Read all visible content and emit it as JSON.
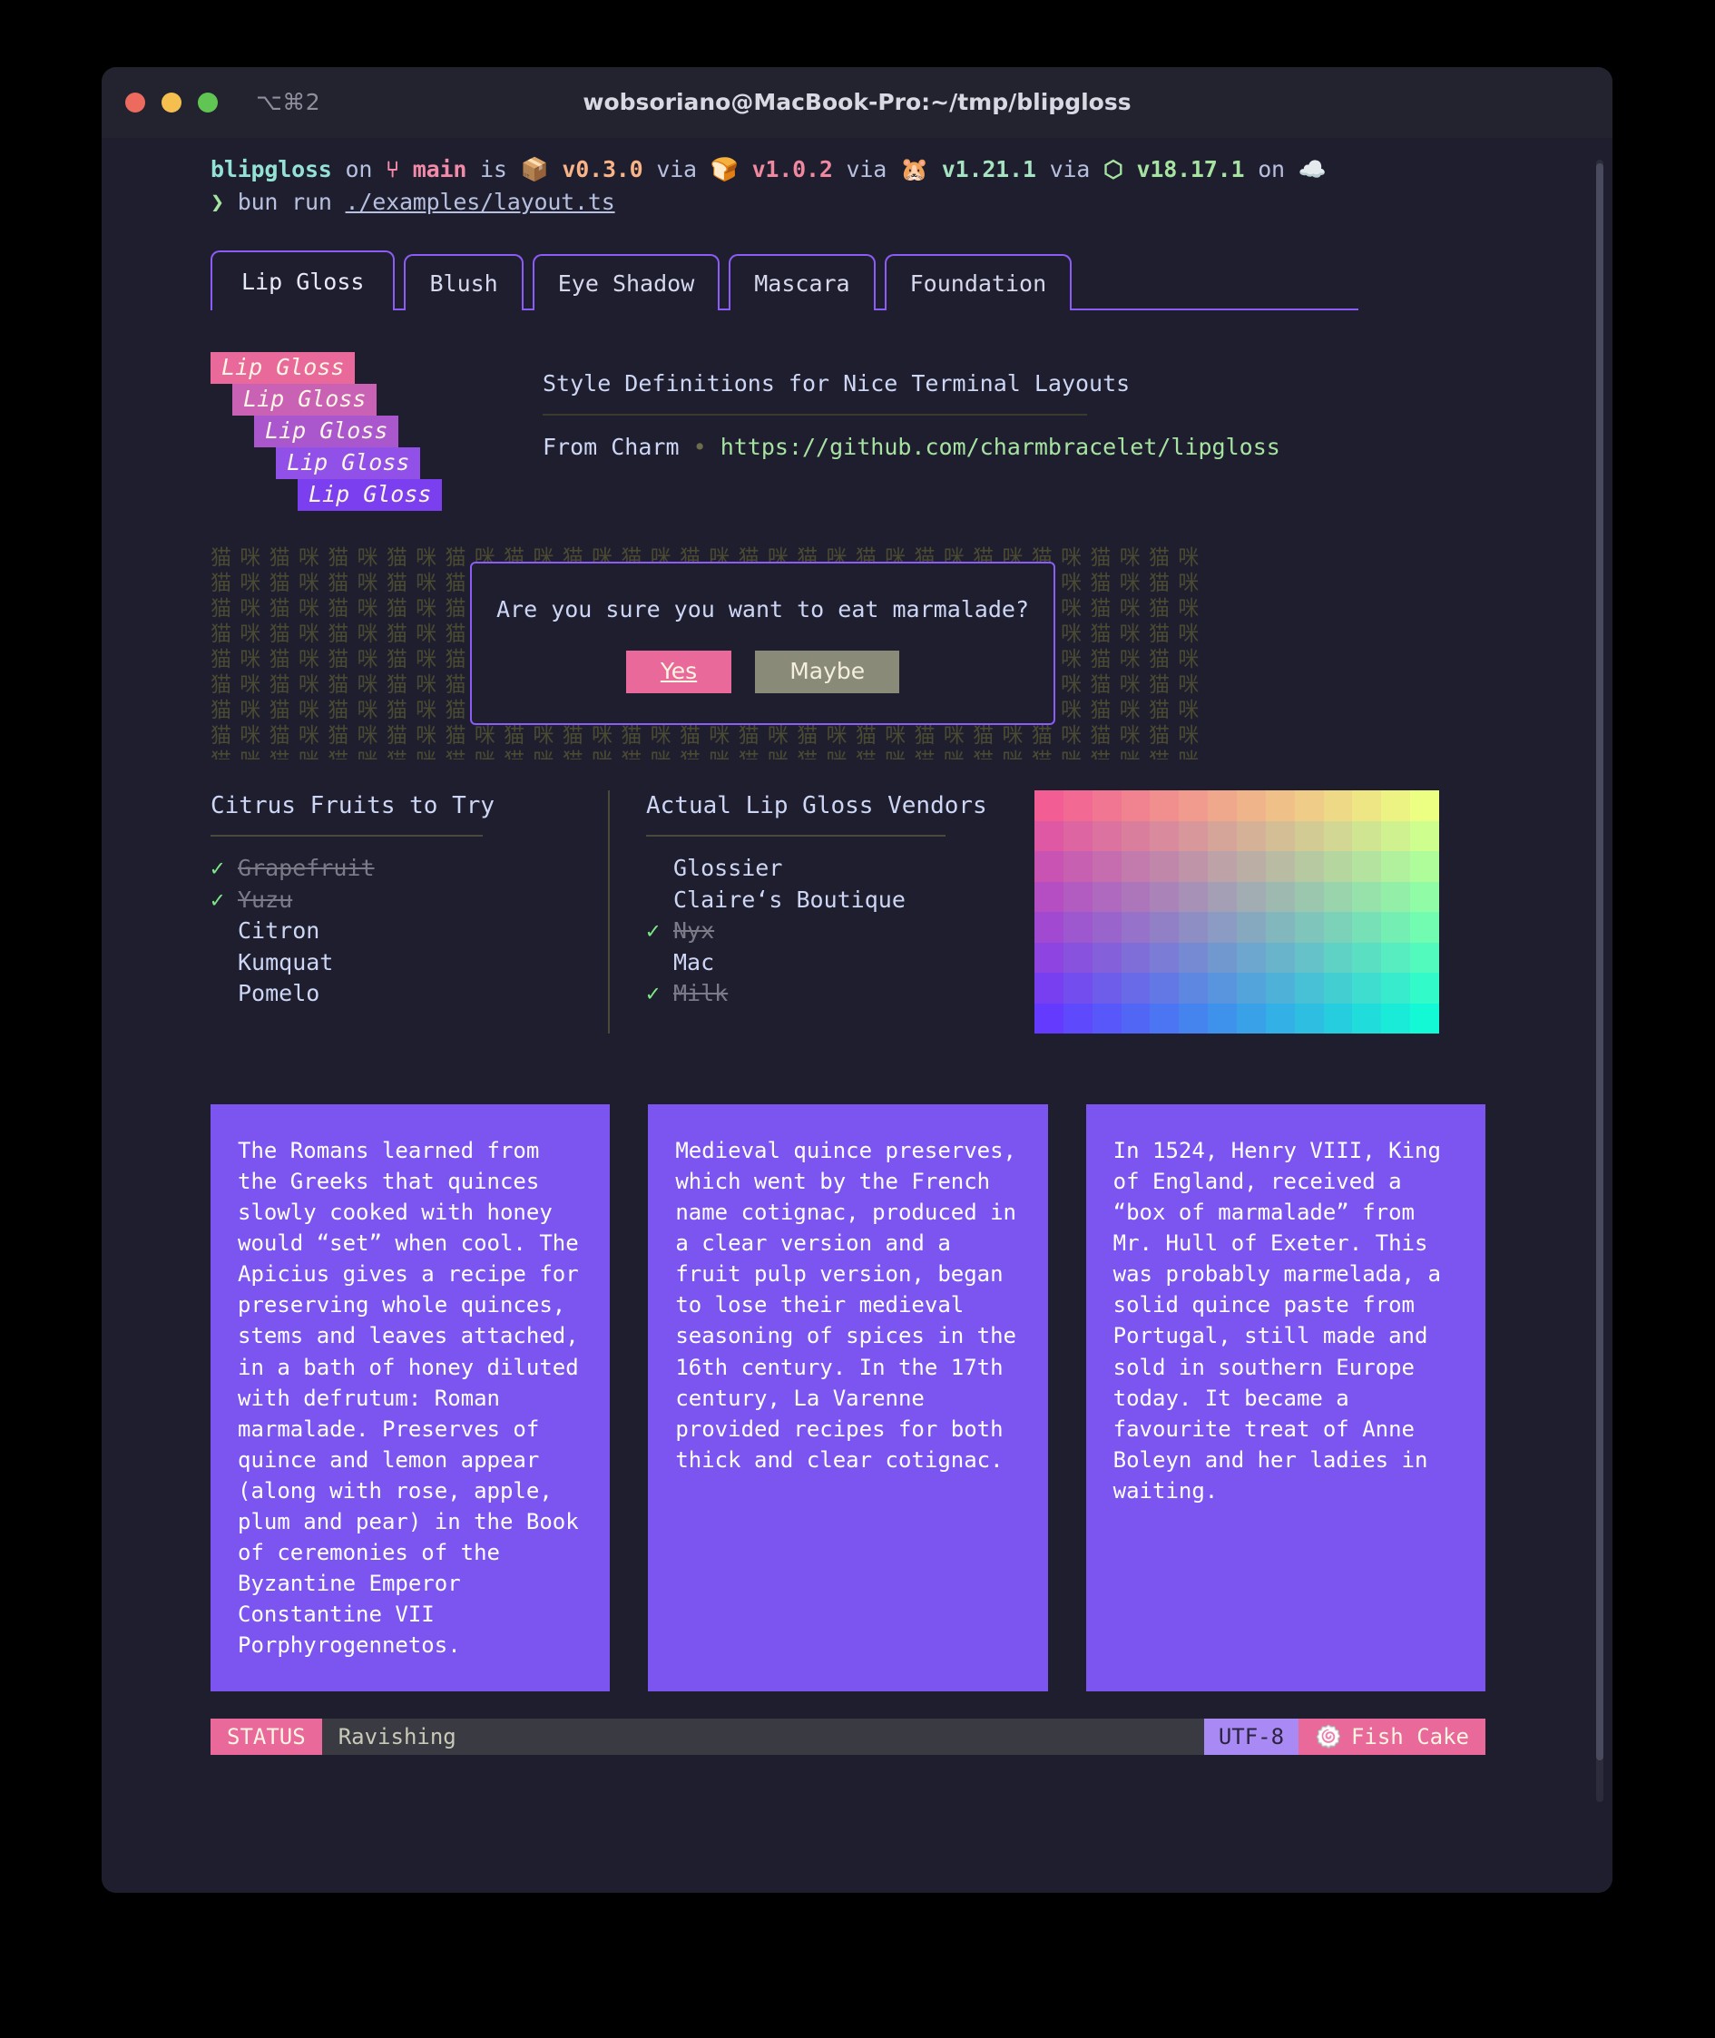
{
  "window": {
    "shortcut": "⌥⌘2",
    "title": "wobsoriano@MacBook-Pro:~/tmp/blipgloss",
    "traffic_lights": [
      "close",
      "minimize",
      "maximize"
    ]
  },
  "prompt": {
    "repo": "blipgloss",
    "on": "on",
    "branch_icon": "⑂",
    "branch": "main",
    "is": "is",
    "pkg_icon": "📦",
    "pkg_version": "v0.3.0",
    "via1": "via",
    "bun_icon": "🍞",
    "bun_version": "v1.0.2",
    "via2": "via",
    "deno_icon": "🐹",
    "deno_version": "v1.21.1",
    "via3": "via",
    "node_icon": "⬡",
    "node_version": "v18.17.1",
    "on2": "on",
    "cloud_icon": "☁️",
    "caret": "❯",
    "command": "bun run",
    "command_arg": "./examples/layout.ts"
  },
  "tabs": [
    {
      "label": "Lip Gloss",
      "active": true
    },
    {
      "label": "Blush",
      "active": false
    },
    {
      "label": "Eye Shadow",
      "active": false
    },
    {
      "label": "Mascara",
      "active": false
    },
    {
      "label": "Foundation",
      "active": false
    }
  ],
  "gradient_title": {
    "lines": [
      "Lip Gloss",
      "Lip Gloss",
      "Lip Gloss",
      "Lip Gloss",
      "Lip Gloss"
    ],
    "colors": [
      "#e8699a",
      "#c961b4",
      "#aa56cd",
      "#9150e8",
      "#7c3ff0"
    ],
    "indents": [
      0,
      24,
      48,
      72,
      96
    ]
  },
  "description": {
    "title": "Style Definitions for Nice Terminal Layouts",
    "from_label": "From Charm",
    "separator": "•",
    "url": "https://github.com/charmbracelet/lipgloss"
  },
  "dialog": {
    "background_glyphs": "猫咪",
    "question": "Are you sure you want to eat marmalade?",
    "buttons": [
      {
        "label": "Yes",
        "style": "primary"
      },
      {
        "label": "Maybe",
        "style": "muted"
      }
    ]
  },
  "lists": [
    {
      "title": "Citrus Fruits to Try",
      "items": [
        {
          "label": "Grapefruit",
          "done": true
        },
        {
          "label": "Yuzu",
          "done": true
        },
        {
          "label": "Citron",
          "done": false
        },
        {
          "label": "Kumquat",
          "done": false
        },
        {
          "label": "Pomelo",
          "done": false
        }
      ]
    },
    {
      "title": "Actual Lip Gloss Vendors",
      "items": [
        {
          "label": "Glossier",
          "done": false
        },
        {
          "label": "Claire‘s Boutique",
          "done": false
        },
        {
          "label": "Nyx",
          "done": true
        },
        {
          "label": "Mac",
          "done": false
        },
        {
          "label": "Milk",
          "done": true
        }
      ]
    }
  ],
  "check_mark": "✓",
  "color_grid": {
    "columns": 14,
    "rows": 8,
    "corners": {
      "top_left": "#f25d94",
      "top_right": "#edff82",
      "bottom_left": "#643aff",
      "bottom_right": "#14f9d5"
    }
  },
  "cards": [
    {
      "text": "The Romans learned from the Greeks that quinces slowly cooked with honey would “set” when cool. The Apicius gives a recipe for preserving whole quinces, stems and leaves attached, in a bath of honey diluted with defrutum: Roman marmalade. Preserves of quince and lemon appear (along with rose, apple, plum and pear) in the Book of ceremonies of the Byzantine Emperor Constantine VII Porphyrogennetos."
    },
    {
      "text": "Medieval quince preserves, which went by the French name cotignac, produced in a clear version and a fruit pulp version, began to lose their medieval seasoning of spices in the 16th century. In the 17th century, La Varenne provided recipes for both thick and clear cotignac."
    },
    {
      "text": "In 1524, Henry VIII, King of England, received a “box of marmalade” from Mr. Hull of Exeter. This was probably marmelada, a solid quince paste from Portugal, still made and sold in southern Europe today. It became a favourite treat of Anne Boleyn and her ladies in waiting."
    }
  ],
  "status_bar": {
    "key": "STATUS",
    "text": "Ravishing",
    "encoding": "UTF-8",
    "fish_icon": "🍥",
    "fish_label": "Fish Cake"
  }
}
